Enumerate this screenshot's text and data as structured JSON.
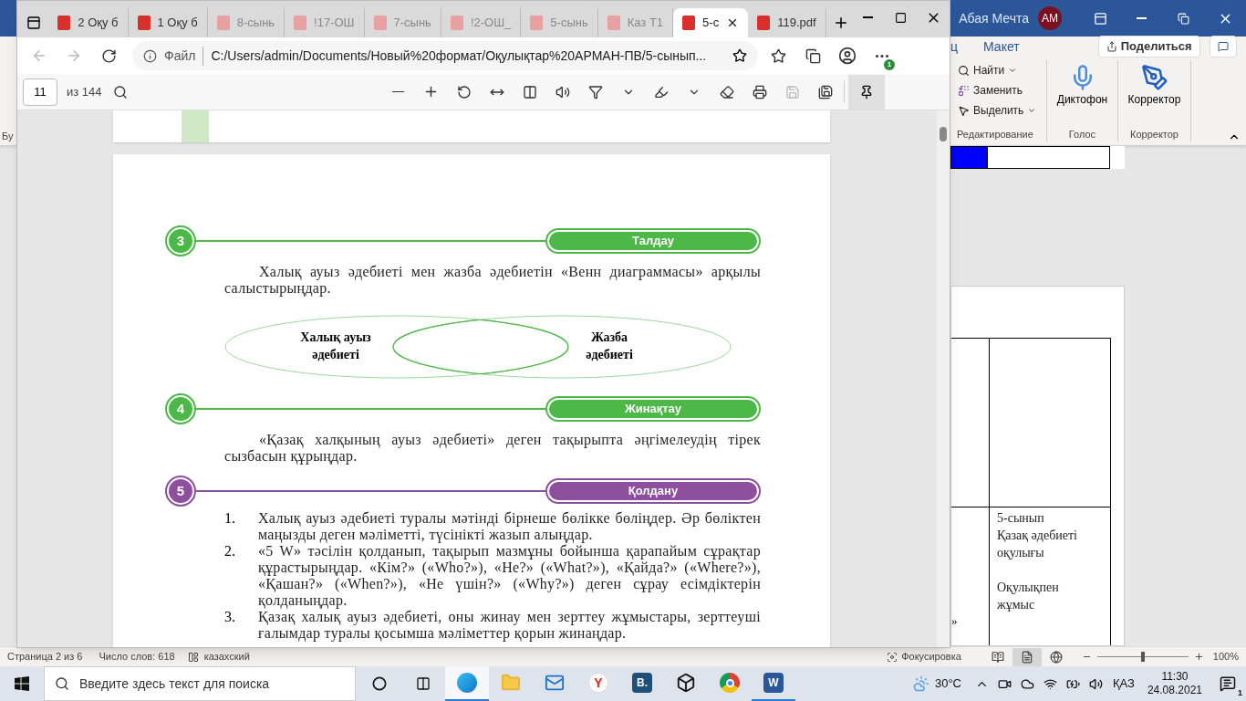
{
  "word": {
    "user": "Абая Мечта",
    "avatar": "AM",
    "tab_partial": "ц",
    "tab": "Макет",
    "share": "Поделиться",
    "clipboard_partial": "Бу",
    "editing": {
      "find": "Найти",
      "replace": "Заменить",
      "select": "Выделить",
      "group": "Редактирование"
    },
    "voice": {
      "button": "Диктофон",
      "group": "Голос"
    },
    "editor": {
      "button": "Корректор",
      "group": "Корректор"
    },
    "table": {
      "left_cell": "»",
      "right_cell_paragraphs": [
        [
          "5-сынып",
          "Қазақ әдебиеті",
          "оқулығы"
        ],
        [
          "Оқулықпен",
          "жұмыс"
        ]
      ]
    },
    "status_bar": {
      "page": "Страница 2 из 6",
      "words": "Число слов: 618",
      "language": "казахский",
      "focus": "Фокусировка",
      "zoom": "100%",
      "zoom_slider": {
        "level": 0.5
      },
      "view_modes": [
        {
          "kind": "read",
          "selected": false
        },
        {
          "kind": "print",
          "selected": true
        },
        {
          "kind": "web",
          "selected": false
        }
      ]
    }
  },
  "browser": {
    "tabs": [
      {
        "label": "2 Оқу б",
        "selected": false,
        "sleeping": false
      },
      {
        "label": "1 Оқу б",
        "selected": false,
        "sleeping": false
      },
      {
        "label": "8-сынь",
        "selected": false,
        "sleeping": true
      },
      {
        "label": "!17-ОШ",
        "selected": false,
        "sleeping": true
      },
      {
        "label": "7-сынь",
        "selected": false,
        "sleeping": true
      },
      {
        "label": "!2-ОШ_",
        "selected": false,
        "sleeping": true
      },
      {
        "label": "5-сынь",
        "selected": false,
        "sleeping": true
      },
      {
        "label": "Каз Т1",
        "selected": false,
        "sleeping": true
      },
      {
        "label": "5-с",
        "selected": true,
        "sleeping": false
      },
      {
        "label": "119.pdf",
        "selected": false,
        "sleeping": false
      }
    ],
    "address": {
      "scheme": "Файл",
      "url": "C:/Users/admin/Documents/Новый%20формат/Оқулықтар%20АРМАН-ПВ/5-сынып..."
    },
    "update_badge": "1",
    "pdf_toolbar": {
      "page": "11",
      "total": "из 144"
    },
    "sections": [
      {
        "number": "3",
        "label": "Талдау",
        "kind": "green",
        "text": "Халық ауыз әдебиеті мен жазба әдебиетін «Венн диаграммасы» арқылы салыстырыңдар.",
        "venn": {
          "left": [
            "Халық ауыз",
            "әдебиеті"
          ],
          "right": [
            "Жазба",
            "әдебиеті"
          ]
        }
      },
      {
        "number": "4",
        "label": "Жинақтау",
        "kind": "green",
        "text": "«Қазақ халқының ауыз әдебиеті» деген тақырыпта әңгімелеудің тірек сызбасын құрыңдар."
      },
      {
        "number": "5",
        "label": "Қолдану",
        "kind": "purple",
        "items": [
          {
            "marker": "1.",
            "text": "Халық ауыз әдебиеті туралы мәтінді бірнеше бөлікке бөліңдер. Әр бөліктен маңызды деген мәліметті, түсінікті жазып алыңдар."
          },
          {
            "marker": "2.",
            "text": "«5 W» тәсілін қолданып, тақырып мазмұны бойынша қарапайым сұрақтар құрастырыңдар. «Кім?» («Who?»), «Не?» («What?»), «Қайда?» («Where?»), «Қашан?» («When?»), «Не үшін?» («Why?») деген сұрау есімдіктерін қолданыңдар."
          },
          {
            "marker": "3.",
            "text": "Қазақ халық ауыз әдебиеті, оны жинау мен зерттеу жұмыстары, зерттеуші ғалымдар туралы қосымша мәліметтер қорын жинаңдар."
          }
        ]
      }
    ]
  },
  "taskbar": {
    "search_placeholder": "Введите здесь текст для поиска",
    "apps": [
      {
        "kind": "edge",
        "running": true,
        "selected": true
      },
      {
        "kind": "explorer",
        "running": false,
        "selected": false
      },
      {
        "kind": "mail",
        "running": false,
        "selected": false
      },
      {
        "kind": "yandex",
        "label": "Y",
        "running": false,
        "selected": false
      },
      {
        "kind": "letter",
        "label": "B.",
        "running": false,
        "selected": false
      },
      {
        "kind": "dropbox",
        "running": false,
        "selected": false
      },
      {
        "kind": "chrome",
        "running": false,
        "selected": false
      },
      {
        "kind": "word",
        "label": "W",
        "running": true,
        "selected": false
      }
    ],
    "temperature": "30°C",
    "language": "ҚАЗ",
    "time": "11:30",
    "date": "24.08.2021",
    "notifications": "1"
  }
}
